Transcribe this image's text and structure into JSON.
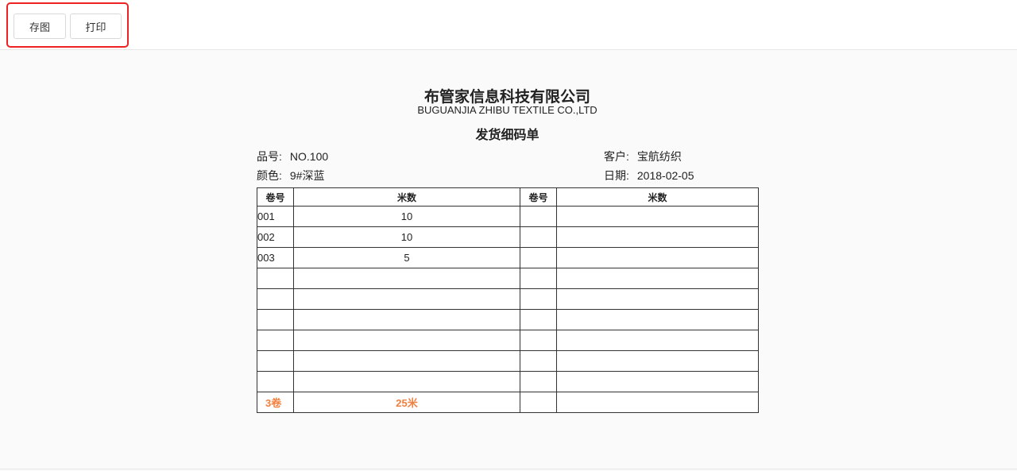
{
  "toolbar": {
    "save_label": "存图",
    "print_label": "打印",
    "highlight_color": "#ee2222"
  },
  "document": {
    "company_name": "布管家信息科技有限公司",
    "company_name_en": "BUGUANJIA ZHIBU TEXTILE CO.,LTD",
    "heading": "发货细码单",
    "product_label": "品号:",
    "product_value": "NO.100",
    "color_label": "颜色:",
    "color_value": "9#深蓝",
    "customer_label": "客户:",
    "customer_value": "宝航纺织",
    "date_label": "日期:",
    "date_value": "2018-02-05"
  },
  "table": {
    "headers": [
      "卷号",
      "米数",
      "卷号",
      "米数"
    ],
    "rows": [
      [
        "001",
        "10",
        "",
        ""
      ],
      [
        "002",
        "10",
        "",
        ""
      ],
      [
        "003",
        "5",
        "",
        ""
      ],
      [
        "",
        "",
        "",
        ""
      ],
      [
        "",
        "",
        "",
        ""
      ],
      [
        "",
        "",
        "",
        ""
      ],
      [
        "",
        "",
        "",
        ""
      ],
      [
        "",
        "",
        "",
        ""
      ],
      [
        "",
        "",
        "",
        ""
      ]
    ],
    "total_rolls": "3卷",
    "total_meters": "25米",
    "total_color": "#f08040"
  }
}
